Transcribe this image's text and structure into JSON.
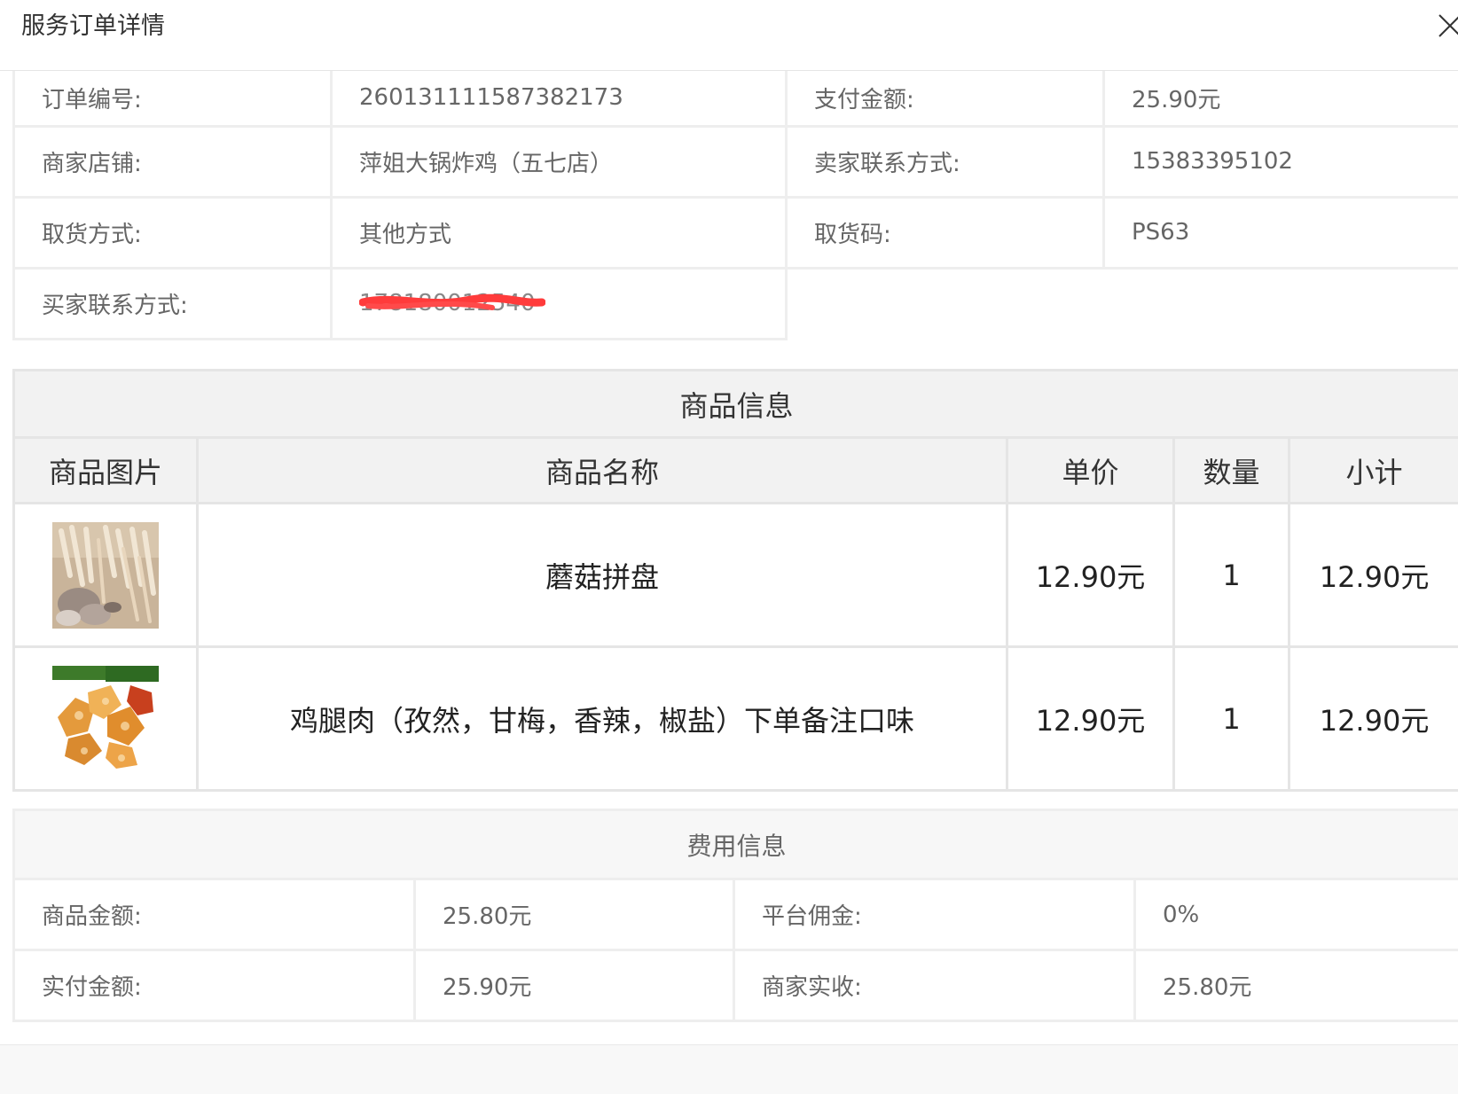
{
  "header": {
    "title": "服务订单详情",
    "close_icon": "close-icon"
  },
  "order_info": {
    "order_no_label": "订单编号:",
    "order_no": "260131111587382173",
    "pay_amount_label": "支付金额:",
    "pay_amount": "25.90元",
    "shop_label": "商家店铺:",
    "shop": "萍姐大锅炸鸡（五七店）",
    "seller_contact_label": "卖家联系方式:",
    "seller_contact": "15383395102",
    "pickup_method_label": "取货方式:",
    "pickup_method": "其他方式",
    "pickup_code_label": "取货码:",
    "pickup_code": "PS63",
    "buyer_contact_label": "买家联系方式:",
    "buyer_contact": "178180012540",
    "redaction_color": "#ff3b3b"
  },
  "goods": {
    "caption": "商品信息",
    "headers": {
      "image": "商品图片",
      "name": "商品名称",
      "price": "单价",
      "qty": "数量",
      "subtotal": "小计"
    },
    "rows": [
      {
        "name": "蘑菇拼盘",
        "price": "12.90元",
        "qty": "1",
        "subtotal": "12.90元",
        "image_icon": "mushroom-platter-image"
      },
      {
        "name": "鸡腿肉（孜然，甘梅，香辣，椒盐）下单备注口味",
        "price": "12.90元",
        "qty": "1",
        "subtotal": "12.90元",
        "image_icon": "fried-chicken-image"
      }
    ]
  },
  "fees": {
    "caption": "费用信息",
    "goods_amount_label": "商品金额:",
    "goods_amount": "25.80元",
    "commission_label": "平台佣金:",
    "commission": "0%",
    "paid_amount_label": "实付金额:",
    "paid_amount": "25.90元",
    "merchant_received_label": "商家实收:",
    "merchant_received": "25.80元"
  }
}
